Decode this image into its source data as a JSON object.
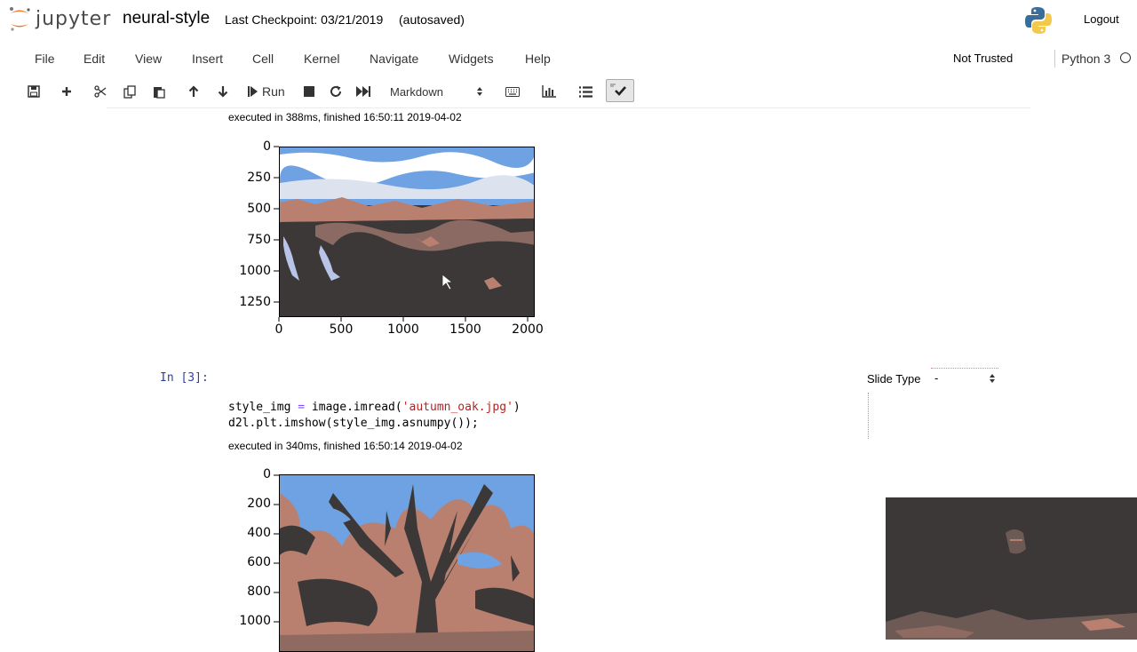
{
  "header": {
    "logo_text": "jupyter",
    "notebook_name": "neural-style",
    "checkpoint": "Last Checkpoint: 03/21/2019",
    "autosave": "(autosaved)",
    "logout_label": "Logout"
  },
  "menubar": {
    "items": [
      "File",
      "Edit",
      "View",
      "Insert",
      "Cell",
      "Kernel",
      "Navigate",
      "Widgets",
      "Help"
    ],
    "trust_status": "Not Trusted",
    "kernel_name": "Python 3"
  },
  "toolbar": {
    "run_label": "Run",
    "cell_type": "Markdown",
    "icons": [
      "save-icon",
      "plus-icon",
      "scissors-icon",
      "copy-icon",
      "paste-icon",
      "arrow-up-icon",
      "arrow-down-icon",
      "run-icon",
      "stop-icon",
      "restart-icon",
      "fast-forward-icon",
      "keyboard-icon",
      "bar-chart-icon",
      "list-icon",
      "check-icon"
    ]
  },
  "cells": {
    "output1": {
      "exec_info": "executed in 388ms, finished 16:50:11 2019-04-02",
      "yticks": [
        "0",
        "250",
        "500",
        "750",
        "1000",
        "1250"
      ],
      "xticks": [
        "0",
        "500",
        "1000",
        "1500",
        "2000"
      ]
    },
    "cell3": {
      "prompt": "In [3]:",
      "code_line1_a": "style_img ",
      "code_line1_op": "=",
      "code_line1_b": " image.imread(",
      "code_line1_str": "'autumn_oak.jpg'",
      "code_line1_c": ")",
      "code_line2": "d2l.plt.imshow(style_img.asnumpy());",
      "exec_info": "executed in 340ms, finished 16:50:14 2019-04-02",
      "yticks": [
        "0",
        "200",
        "400",
        "600",
        "800",
        "1000"
      ],
      "slide_type_label": "Slide Type",
      "slide_type_value": "-"
    }
  },
  "colors": {
    "prompt": "#303f9f",
    "string": "#ba2121",
    "operator": "#7c4dff",
    "photo_dark": "#3d3838",
    "photo_sky": "#6fa2e2",
    "photo_rust": "#b98070"
  }
}
